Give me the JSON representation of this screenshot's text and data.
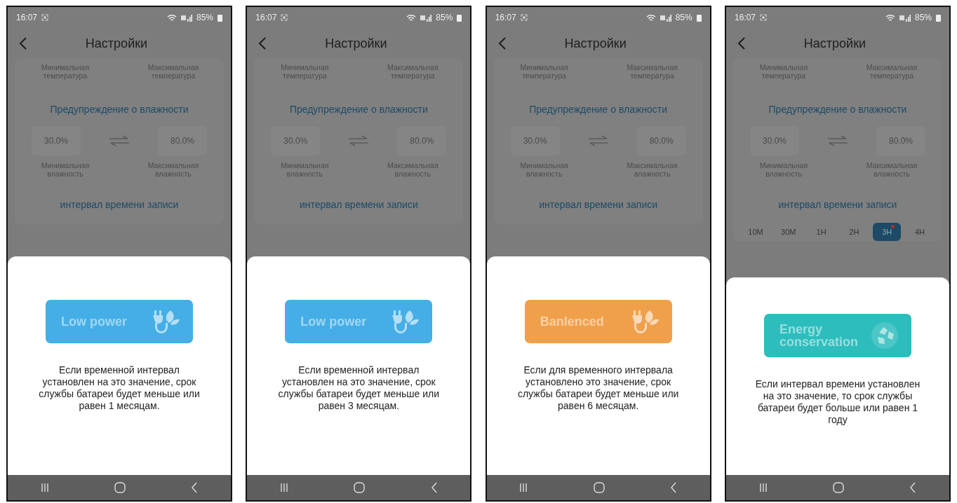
{
  "phones": [
    {
      "status": {
        "time": "16:07",
        "battery": "85%"
      },
      "title": "Настройки",
      "temperature_labels": [
        "Минимальная температура",
        "Максимальная температура"
      ],
      "humidity_heading": "Предупреждение о влажности",
      "humidity_values": [
        "30.0%",
        "80.0%"
      ],
      "humidity_labels": [
        "Минимальная влажность",
        "Максимальная влажность"
      ],
      "interval_heading": "интервал времени записи",
      "mode": {
        "label": "Low power",
        "kind": "plug",
        "color": "#45aee6"
      },
      "description": "Если временной интервал установлен на это значение, срок службы батареи будет меньше или равен 1 месяцам."
    },
    {
      "status": {
        "time": "16:07",
        "battery": "85%"
      },
      "title": "Настройки",
      "temperature_labels": [
        "Минимальная температура",
        "Максимальная температура"
      ],
      "humidity_heading": "Предупреждение о влажности",
      "humidity_values": [
        "30.0%",
        "80.0%"
      ],
      "humidity_labels": [
        "Минимальная влажность",
        "Максимальная влажность"
      ],
      "interval_heading": "интервал времени записи",
      "mode": {
        "label": "Low power",
        "kind": "plug",
        "color": "#45aee6"
      },
      "description": "Если временной интервал установлен на это значение, срок службы батареи будет меньше или равен 3 месяцам."
    },
    {
      "status": {
        "time": "16:07",
        "battery": "85%"
      },
      "title": "Настройки",
      "temperature_labels": [
        "Минимальная температура",
        "Максимальная температура"
      ],
      "humidity_heading": "Предупреждение о влажности",
      "humidity_values": [
        "30.0%",
        "80.0%"
      ],
      "humidity_labels": [
        "Минимальная влажность",
        "Максимальная влажность"
      ],
      "interval_heading": "интервал времени записи",
      "mode": {
        "label": "Banlenced",
        "kind": "plug",
        "color": "#f0a04b"
      },
      "description": "Если для временного интервала установлено это значение, срок службы батареи будет меньше или равен 6 месяцам."
    },
    {
      "status": {
        "time": "16:07",
        "battery": "85%"
      },
      "title": "Настройки",
      "temperature_labels": [
        "Минимальная температура",
        "Максимальная температура"
      ],
      "humidity_heading": "Предупреждение о влажности",
      "humidity_values": [
        "30.0%",
        "80.0%"
      ],
      "humidity_labels": [
        "Минимальная влажность",
        "Максимальная влажность"
      ],
      "interval_heading": "интервал времени записи",
      "interval_options": [
        {
          "label": "10M",
          "selected": false
        },
        {
          "label": "30M",
          "selected": false
        },
        {
          "label": "1H",
          "selected": false
        },
        {
          "label": "2H",
          "selected": false
        },
        {
          "label": "3H",
          "selected": true
        },
        {
          "label": "4H",
          "selected": false
        }
      ],
      "mode": {
        "label": "Energy conservation",
        "kind": "recycle",
        "color": "#2dbdbd"
      },
      "description": "Если интервал времени установлен на это значение, то срок службы батареи будет больше или равен 1 году"
    }
  ]
}
